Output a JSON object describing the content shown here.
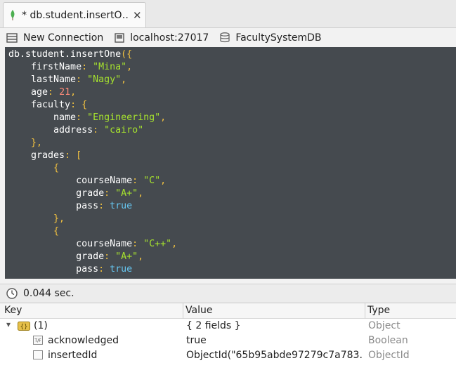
{
  "tab": {
    "title": "* db.student.insertO…",
    "close": "✕"
  },
  "connection": {
    "new_label": "New Connection",
    "host": "localhost:27017",
    "database": "FacultySystemDB"
  },
  "editor": {
    "lines": [
      [
        {
          "t": "k",
          "v": "db.student.insertOne"
        },
        {
          "t": "p",
          "v": "({"
        }
      ],
      [
        {
          "t": "k",
          "v": "    firstName"
        },
        {
          "t": "p",
          "v": ": "
        },
        {
          "t": "s",
          "v": "\"Mina\""
        },
        {
          "t": "p",
          "v": ","
        }
      ],
      [
        {
          "t": "k",
          "v": "    lastName"
        },
        {
          "t": "p",
          "v": ": "
        },
        {
          "t": "s",
          "v": "\"Nagy\""
        },
        {
          "t": "p",
          "v": ","
        }
      ],
      [
        {
          "t": "k",
          "v": "    age"
        },
        {
          "t": "p",
          "v": ": "
        },
        {
          "t": "n",
          "v": "21"
        },
        {
          "t": "p",
          "v": ","
        }
      ],
      [
        {
          "t": "k",
          "v": "    faculty"
        },
        {
          "t": "p",
          "v": ": {"
        }
      ],
      [
        {
          "t": "k",
          "v": "        name"
        },
        {
          "t": "p",
          "v": ": "
        },
        {
          "t": "s",
          "v": "\"Engineering\""
        },
        {
          "t": "p",
          "v": ","
        }
      ],
      [
        {
          "t": "k",
          "v": "        address"
        },
        {
          "t": "p",
          "v": ": "
        },
        {
          "t": "s",
          "v": "\"cairo\""
        }
      ],
      [
        {
          "t": "p",
          "v": "    },"
        }
      ],
      [
        {
          "t": "k",
          "v": "    grades"
        },
        {
          "t": "p",
          "v": ": ["
        }
      ],
      [
        {
          "t": "p",
          "v": "        {"
        }
      ],
      [
        {
          "t": "k",
          "v": "            courseName"
        },
        {
          "t": "p",
          "v": ": "
        },
        {
          "t": "s",
          "v": "\"C\""
        },
        {
          "t": "p",
          "v": ","
        }
      ],
      [
        {
          "t": "k",
          "v": "            grade"
        },
        {
          "t": "p",
          "v": ": "
        },
        {
          "t": "s",
          "v": "\"A+\""
        },
        {
          "t": "p",
          "v": ","
        }
      ],
      [
        {
          "t": "k",
          "v": "            pass"
        },
        {
          "t": "p",
          "v": ": "
        },
        {
          "t": "b",
          "v": "true"
        }
      ],
      [
        {
          "t": "p",
          "v": "        },"
        }
      ],
      [
        {
          "t": "p",
          "v": "        {"
        }
      ],
      [
        {
          "t": "k",
          "v": "            courseName"
        },
        {
          "t": "p",
          "v": ": "
        },
        {
          "t": "s",
          "v": "\"C++\""
        },
        {
          "t": "p",
          "v": ","
        }
      ],
      [
        {
          "t": "k",
          "v": "            grade"
        },
        {
          "t": "p",
          "v": ": "
        },
        {
          "t": "s",
          "v": "\"A+\""
        },
        {
          "t": "p",
          "v": ","
        }
      ],
      [
        {
          "t": "k",
          "v": "            pass"
        },
        {
          "t": "p",
          "v": ": "
        },
        {
          "t": "b",
          "v": "true"
        }
      ]
    ]
  },
  "status": {
    "time": "0.044 sec."
  },
  "results": {
    "columns": {
      "key": "Key",
      "value": "Value",
      "type": "Type"
    },
    "rows": [
      {
        "key": "(1)",
        "value": "{ 2 fields }",
        "type": "Object",
        "icon": "object-icon",
        "expander": "▾"
      },
      {
        "key": "acknowledged",
        "value": "true",
        "type": "Boolean",
        "icon": "boolean-icon"
      },
      {
        "key": "insertedId",
        "value": "ObjectId(\"65b95abde97279c7a783…",
        "type": "ObjectId",
        "icon": "objectid-icon"
      }
    ]
  },
  "colors": {
    "editor_bg": "#454a4f",
    "keyword": "#ffffff",
    "punctuation": "#f0c040",
    "string": "#a6e22e",
    "number": "#ff8c7a",
    "boolean": "#66c6f0",
    "mongo_leaf": "#4caf50"
  }
}
